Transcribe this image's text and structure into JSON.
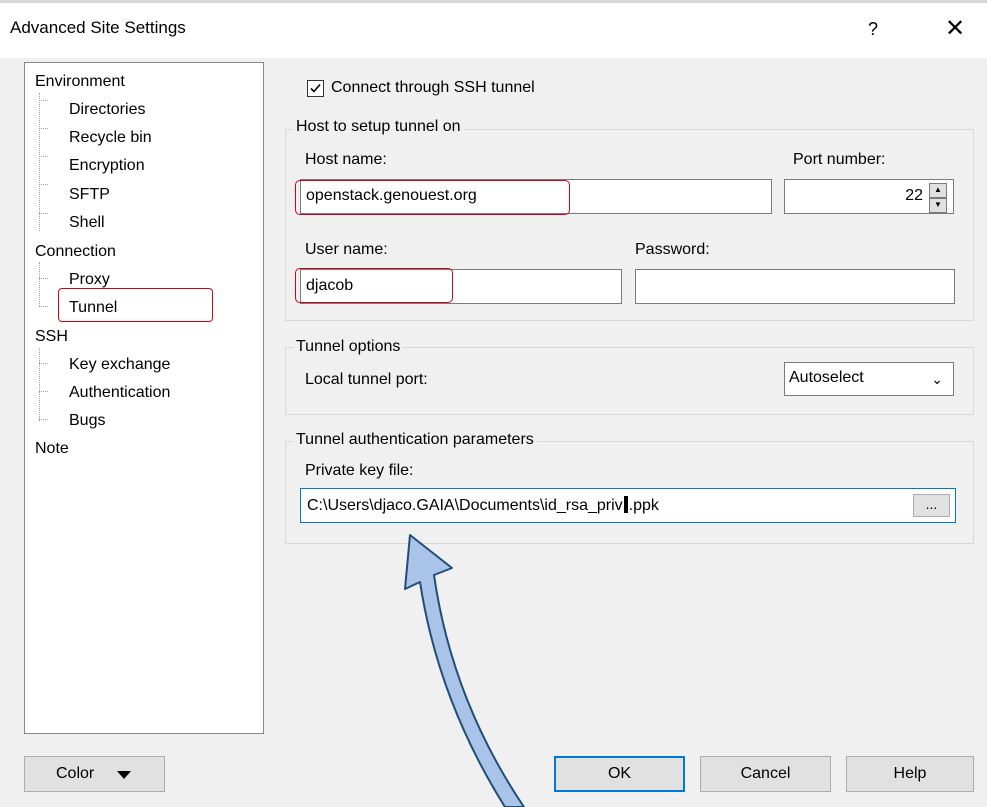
{
  "window": {
    "title": "Advanced Site Settings",
    "help_label": "?",
    "close_label": "✕"
  },
  "tree": {
    "environment": "Environment",
    "directories": "Directories",
    "recycle_bin": "Recycle bin",
    "encryption": "Encryption",
    "sftp": "SFTP",
    "shell": "Shell",
    "connection": "Connection",
    "proxy": "Proxy",
    "tunnel": "Tunnel",
    "ssh": "SSH",
    "key_exchange": "Key exchange",
    "authentication": "Authentication",
    "bugs": "Bugs",
    "note": "Note",
    "selected": "Tunnel"
  },
  "tunnel": {
    "connect_label": "Connect through SSH tunnel",
    "connect_checked": true,
    "host_group_title": "Host to setup tunnel on",
    "host_name_label": "Host name:",
    "host_name_value": "openstack.genouest.org",
    "port_label": "Port number:",
    "port_value": "22",
    "user_name_label": "User name:",
    "user_name_value": "djacob",
    "password_label": "Password:",
    "password_value": "",
    "options_group_title": "Tunnel options",
    "local_port_label": "Local tunnel port:",
    "local_port_value": "Autoselect",
    "auth_group_title": "Tunnel authentication parameters",
    "private_key_label": "Private key file:",
    "private_key_before_cursor": "C:\\Users\\djaco.GAIA\\Documents\\id_rsa_priv",
    "private_key_after_cursor": ".ppk",
    "browse_label": "..."
  },
  "buttons": {
    "color": "Color",
    "ok": "OK",
    "cancel": "Cancel",
    "help": "Help"
  },
  "colors": {
    "highlight": "#d0021b",
    "focus": "#0078d7",
    "annotation_arrow": "#1f4e79"
  }
}
